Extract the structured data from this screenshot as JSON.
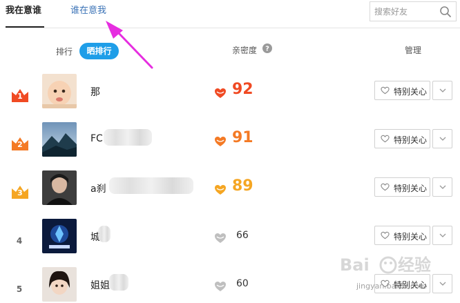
{
  "tabs": [
    {
      "label": "我在意谁",
      "active": true
    },
    {
      "label": "谁在意我",
      "active": false
    }
  ],
  "search": {
    "placeholder": "搜索好友"
  },
  "header": {
    "sort_rank": "排行",
    "sort_show": "晒排行",
    "intimacy": "亲密度",
    "manage": "管理"
  },
  "rows": [
    {
      "rank": "1",
      "name": "那",
      "score": "92",
      "care_label": "特别关心",
      "crown_color": "#f04a23",
      "heart_color": "#f04a23"
    },
    {
      "rank": "2",
      "name": "FC",
      "score": "91",
      "care_label": "特别关心",
      "crown_color": "#f47a25",
      "heart_color": "#f47a25"
    },
    {
      "rank": "3",
      "name": "a刹",
      "score": "89",
      "care_label": "特别关心",
      "crown_color": "#f5a623",
      "heart_color": "#f5a623"
    },
    {
      "rank": "4",
      "name": "城",
      "score": "66",
      "care_label": "特别关心",
      "heart_color": "#bfbfbf"
    },
    {
      "rank": "5",
      "name": "姐姐",
      "score": "60",
      "care_label": "特别关心",
      "heart_color": "#bfbfbf"
    }
  ],
  "colors": {
    "accent": "#1f9ee8",
    "tab_link": "#3a72b6",
    "annotation_arrow": "#e62ee0"
  },
  "watermark": {
    "text": "jingyan.baidu.com"
  }
}
